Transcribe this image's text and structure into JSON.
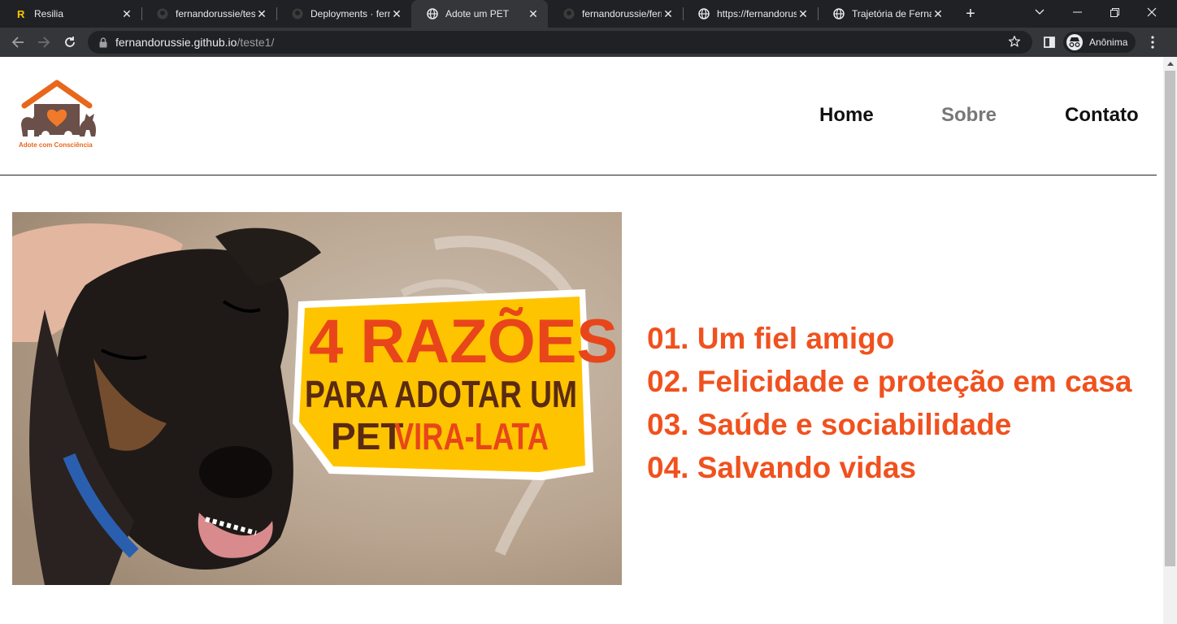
{
  "browser": {
    "tabs": [
      {
        "title": "Resilia",
        "icon": "resilia-icon",
        "active": false
      },
      {
        "title": "fernandorussie/teste",
        "icon": "github-icon",
        "active": false
      },
      {
        "title": "Deployments · fernandorussie",
        "icon": "github-icon",
        "active": false
      },
      {
        "title": "Adote um PET",
        "icon": "globe-icon",
        "active": true
      },
      {
        "title": "fernandorussie/fernandorussie",
        "icon": "github-icon",
        "active": false
      },
      {
        "title": "https://fernandorussie",
        "icon": "globe-icon",
        "active": false
      },
      {
        "title": "Trajetória de Fernando",
        "icon": "globe-icon",
        "active": false
      }
    ],
    "url": {
      "host": "fernandorussie.github.io",
      "path": "/teste1/"
    },
    "profile_label": "Anônima"
  },
  "site": {
    "logo_caption": "Adote com Consciência",
    "nav": [
      {
        "label": "Home"
      },
      {
        "label": "Sobre"
      },
      {
        "label": "Contato"
      }
    ],
    "hero": {
      "headline_line1": "4 RAZÕES",
      "headline_line2": "PARA ADOTAR UM",
      "headline_line3_a": "PET",
      "headline_line3_b": "VIRA-LATA"
    },
    "reasons": [
      "01. Um fiel amigo",
      "02. Felicidade e proteção em casa",
      "03. Saúde e sociabilidade",
      "04. Salvando vidas"
    ]
  },
  "colors": {
    "accent": "#f0511e",
    "logo_orange": "#e8671b",
    "nav_muted": "#777777",
    "headline_yellow": "#ffc400",
    "headline_brown": "#5a2a12"
  }
}
